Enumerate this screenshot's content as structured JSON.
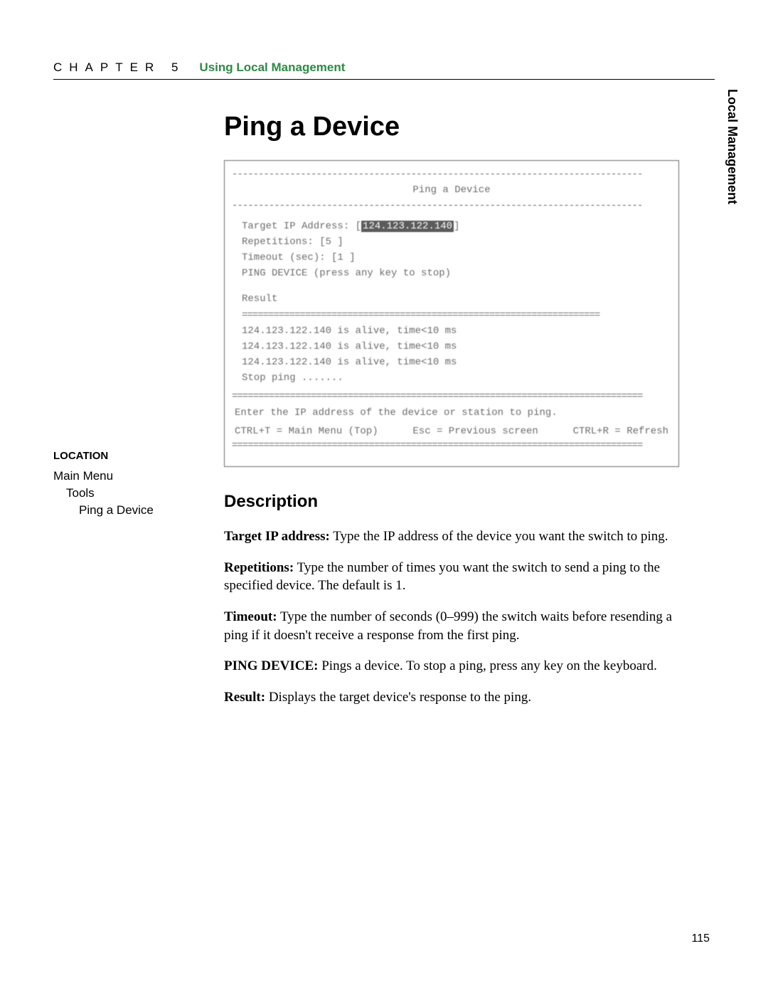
{
  "header": {
    "chapter_label": "CHAPTER 5",
    "chapter_title": "Using Local Management"
  },
  "side_tab": "Local Management",
  "page_title": "Ping a Device",
  "screenshot": {
    "title": "Ping a Device",
    "target_label": "Target IP Address:",
    "target_value": "124.123.122.140",
    "reps_line": "Repetitions: [5  ]",
    "timeout_line": "Timeout (sec): [1  ]",
    "ping_line": "PING DEVICE  (press any key to stop)",
    "result_label": "Result",
    "result_lines": [
      "124.123.122.140 is alive, time<10 ms",
      "124.123.122.140 is alive, time<10 ms",
      "124.123.122.140 is alive, time<10 ms",
      "Stop ping ......."
    ],
    "hint": "Enter the IP address of the device or station to ping.",
    "footer_left": "CTRL+T = Main Menu (Top)",
    "footer_mid": "Esc = Previous screen",
    "footer_right": "CTRL+R = Refresh"
  },
  "description": {
    "heading": "Description",
    "paras": [
      {
        "b": "Target IP address:",
        "t": " Type the IP address of the device you want the switch to ping."
      },
      {
        "b": "Repetitions:",
        "t": " Type the number of times you want the switch to send a ping to the specified device. The default is 1."
      },
      {
        "b": "Timeout:",
        "t": " Type the number of seconds (0–999) the switch waits before resending a ping if it doesn't receive a response from the first ping."
      },
      {
        "b": "PING DEVICE:",
        "t": " Pings a device. To stop a ping, press any key on the keyboard."
      },
      {
        "b": "Result:",
        "t": " Displays the target device's response to the ping."
      }
    ]
  },
  "location": {
    "heading": "LOCATION",
    "items": [
      "Main Menu",
      "Tools",
      "Ping a Device"
    ]
  },
  "page_number": "115",
  "chart_data": null
}
